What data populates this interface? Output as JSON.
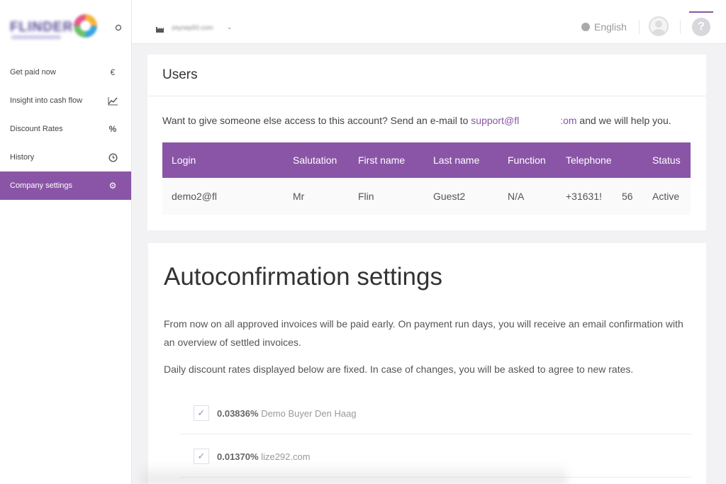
{
  "sidebar": {
    "logo_text": "FLINDER",
    "items": [
      {
        "label": "Get paid now",
        "icon": "euro-icon",
        "glyph": "€"
      },
      {
        "label": "Insight into cash flow",
        "icon": "chart-line-icon",
        "glyph": ""
      },
      {
        "label": "Discount Rates",
        "icon": "percent-icon",
        "glyph": "%"
      },
      {
        "label": "History",
        "icon": "clock-icon",
        "glyph": ""
      },
      {
        "label": "Company settings",
        "icon": "gears-icon",
        "glyph": "⚙"
      }
    ],
    "active_index": 4,
    "accent": "#8a55a6"
  },
  "topbar": {
    "company": "zeynep50.com",
    "chevron": "⌄",
    "language": "English",
    "help": "?"
  },
  "users": {
    "title": "Users",
    "info_before": "Want to give someone else access to this account? Send an e-mail to ",
    "info_link_a": "support@fl",
    "info_link_b": ":om",
    "info_after": " and we will help you.",
    "columns": [
      "Login",
      "Salutation",
      "First name",
      "Last name",
      "Function",
      "Telephone",
      "Status"
    ],
    "rows": [
      {
        "login": "demo2@fl",
        "salutation": "Mr",
        "first_name": "Flin",
        "last_name": "Guest2",
        "function": "N/A",
        "telephone": "+31631!",
        "telephone_tail": "56",
        "status": "Active"
      }
    ]
  },
  "autoconfirmation": {
    "title": "Autoconfirmation settings",
    "paragraph1": "From now on all approved invoices will be paid early. On payment run days, you will receive an email confirmation with an overview of settled invoices.",
    "paragraph2": "Daily discount rates displayed below are fixed. In case of changes, you will be asked to agree to new rates.",
    "rates": [
      {
        "rate": "0.03836%",
        "buyer": "Demo Buyer Den Haag",
        "checked": true
      },
      {
        "rate": "0.01370%",
        "buyer": "lize292.com",
        "checked": true
      }
    ]
  }
}
